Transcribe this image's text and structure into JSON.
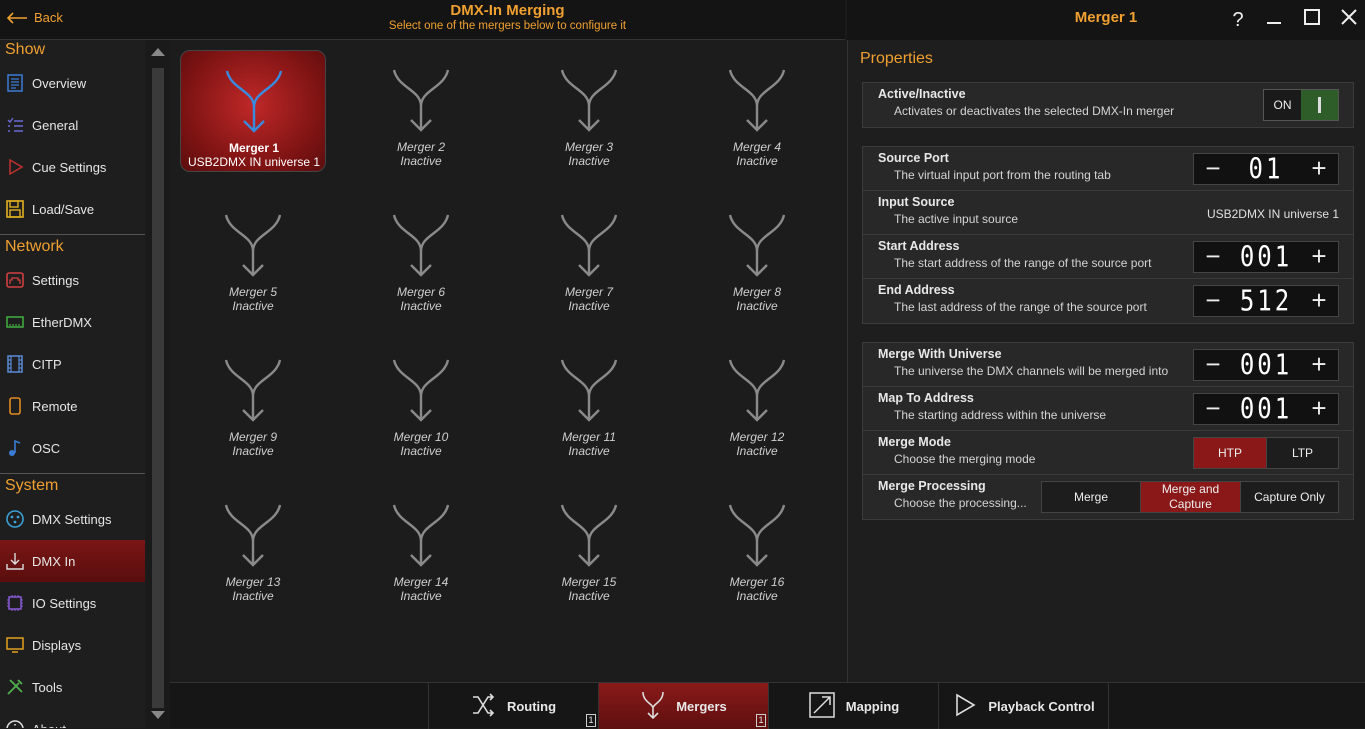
{
  "header": {
    "back_label": "Back",
    "title": "DMX-In Merging",
    "subtitle": "Select one of the mergers below to configure it"
  },
  "right_header": {
    "title": "Merger 1",
    "help": "?",
    "minimize": "—",
    "maximize": "☐",
    "close": "✕"
  },
  "sidebar": {
    "sections": [
      {
        "title": "Show",
        "items": [
          {
            "label": "Overview",
            "icon": "overview-icon",
            "color": "#3a7bd5"
          },
          {
            "label": "General",
            "icon": "list-icon",
            "color": "#6a6ad5"
          },
          {
            "label": "Cue Settings",
            "icon": "play-icon",
            "color": "#c03030"
          },
          {
            "label": "Load/Save",
            "icon": "floppy-icon",
            "color": "#e0b020"
          }
        ]
      },
      {
        "title": "Network",
        "items": [
          {
            "label": "Settings",
            "icon": "network-settings-icon",
            "color": "#d04040"
          },
          {
            "label": "EtherDMX",
            "icon": "ethernet-icon",
            "color": "#40b040"
          },
          {
            "label": "CITP",
            "icon": "film-icon",
            "color": "#5a8ad5"
          },
          {
            "label": "Remote",
            "icon": "phone-icon",
            "color": "#e08a20"
          },
          {
            "label": "OSC",
            "icon": "note-icon",
            "color": "#3a7bd5"
          }
        ]
      },
      {
        "title": "System",
        "items": [
          {
            "label": "DMX Settings",
            "icon": "dmx-connector-icon",
            "color": "#3aa0d5"
          },
          {
            "label": "DMX In",
            "icon": "dmx-in-icon",
            "color": "#dddddd",
            "active": true
          },
          {
            "label": "IO Settings",
            "icon": "chip-icon",
            "color": "#8a5ad5"
          },
          {
            "label": "Displays",
            "icon": "display-icon",
            "color": "#e0a020"
          },
          {
            "label": "Tools",
            "icon": "tools-icon",
            "color": "#50b050"
          },
          {
            "label": "About",
            "icon": "info-icon",
            "color": "#dddddd"
          }
        ]
      }
    ]
  },
  "mergers": [
    {
      "name": "Merger 1",
      "status": "USB2DMX IN universe 1",
      "selected": true
    },
    {
      "name": "Merger 2",
      "status": "Inactive"
    },
    {
      "name": "Merger 3",
      "status": "Inactive"
    },
    {
      "name": "Merger 4",
      "status": "Inactive"
    },
    {
      "name": "Merger 5",
      "status": "Inactive"
    },
    {
      "name": "Merger 6",
      "status": "Inactive"
    },
    {
      "name": "Merger 7",
      "status": "Inactive"
    },
    {
      "name": "Merger 8",
      "status": "Inactive"
    },
    {
      "name": "Merger 9",
      "status": "Inactive"
    },
    {
      "name": "Merger 10",
      "status": "Inactive"
    },
    {
      "name": "Merger 11",
      "status": "Inactive"
    },
    {
      "name": "Merger 12",
      "status": "Inactive"
    },
    {
      "name": "Merger 13",
      "status": "Inactive"
    },
    {
      "name": "Merger 14",
      "status": "Inactive"
    },
    {
      "name": "Merger 15",
      "status": "Inactive"
    },
    {
      "name": "Merger 16",
      "status": "Inactive"
    }
  ],
  "properties": {
    "title": "Properties",
    "active": {
      "title": "Active/Inactive",
      "desc": "Activates or deactivates the selected DMX-In merger",
      "state": "ON"
    },
    "source_port": {
      "title": "Source Port",
      "desc": "The virtual input port from the routing tab",
      "value": "01"
    },
    "input_source": {
      "title": "Input Source",
      "desc": "The active input source",
      "value": "USB2DMX IN universe 1"
    },
    "start_address": {
      "title": "Start Address",
      "desc": "The start address of the range of the source port",
      "value": "001"
    },
    "end_address": {
      "title": "End Address",
      "desc": "The last address of the range of the source port",
      "value": "512"
    },
    "merge_universe": {
      "title": "Merge With Universe",
      "desc": "The universe the DMX channels will be merged into",
      "value": "001"
    },
    "map_address": {
      "title": "Map To Address",
      "desc": "The starting address within the universe",
      "value": "001"
    },
    "merge_mode": {
      "title": "Merge Mode",
      "desc": "Choose the merging mode",
      "options": [
        "HTP",
        "LTP"
      ],
      "selected": "HTP"
    },
    "merge_processing": {
      "title": "Merge Processing",
      "desc": "Choose  the  processing...",
      "options": [
        "Merge",
        "Merge and Capture",
        "Capture Only"
      ],
      "selected": "Merge and Capture"
    }
  },
  "bottom_tabs": [
    {
      "label": "Routing",
      "icon": "routing-icon",
      "badge": "1"
    },
    {
      "label": "Mergers",
      "icon": "merge-icon",
      "badge": "1",
      "active": true
    },
    {
      "label": "Mapping",
      "icon": "mapping-icon"
    },
    {
      "label": "Playback Control",
      "icon": "play-icon"
    }
  ],
  "colors": {
    "accent": "#f0a030",
    "selected_red": "#8a1818",
    "toggle_green": "#2e5d2a",
    "merger_active_arrow": "#3a8ae0",
    "merger_inactive_arrow": "#8a8a8a"
  }
}
